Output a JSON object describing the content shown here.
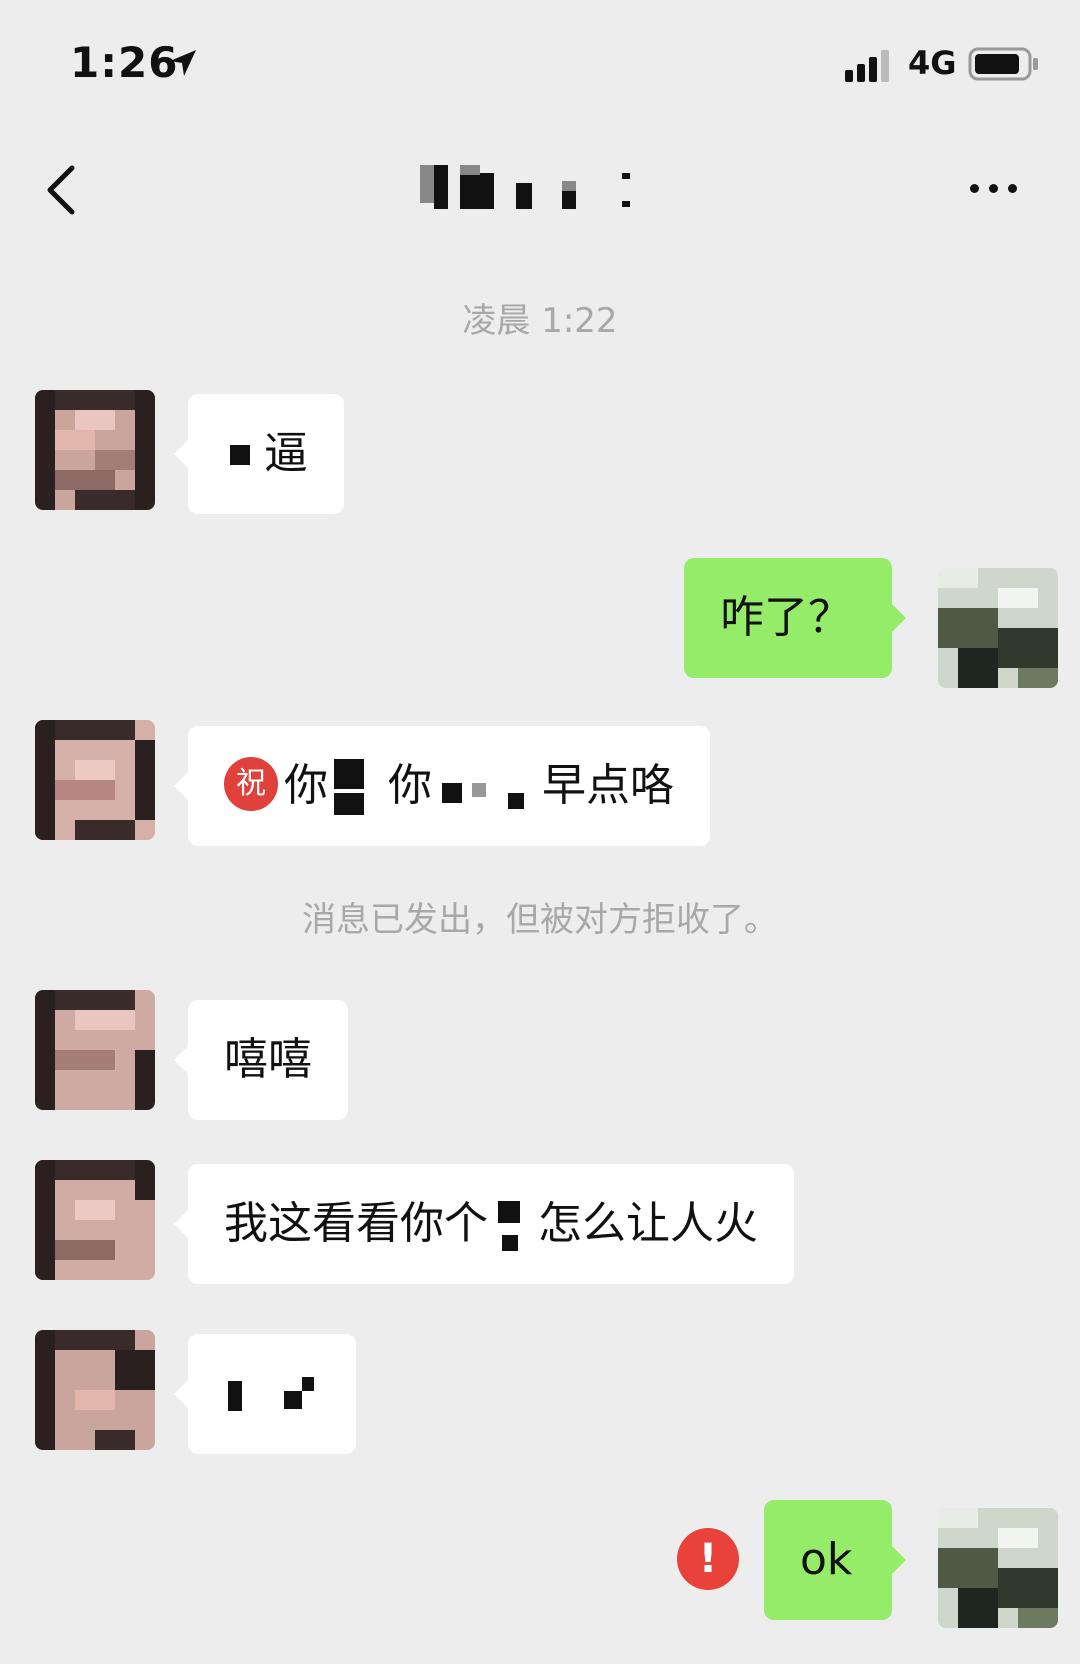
{
  "status_bar": {
    "time": "1:26",
    "network": "4G"
  },
  "nav": {
    "title": ""
  },
  "chat": {
    "timestamp": "凌晨 1:22",
    "messages": [
      {
        "side": "left",
        "text": "逼"
      },
      {
        "side": "right",
        "text": "咋了？"
      },
      {
        "side": "left",
        "badge": "祝",
        "part1": "你",
        "part2": "你",
        "part3": "早点咯"
      },
      {
        "side": "left",
        "text": "嘻嘻"
      },
      {
        "side": "left",
        "part1": "我这看看你个",
        "part2": "怎么让人火"
      },
      {
        "side": "left",
        "text": ""
      },
      {
        "side": "right",
        "text": "ok",
        "status": "!"
      }
    ],
    "system_notice": "消息已发出，但被对方拒收了。"
  },
  "colors": {
    "background": "#ededed",
    "sent_bubble": "#95ec69",
    "received_bubble": "#ffffff",
    "error": "#e8423a"
  }
}
